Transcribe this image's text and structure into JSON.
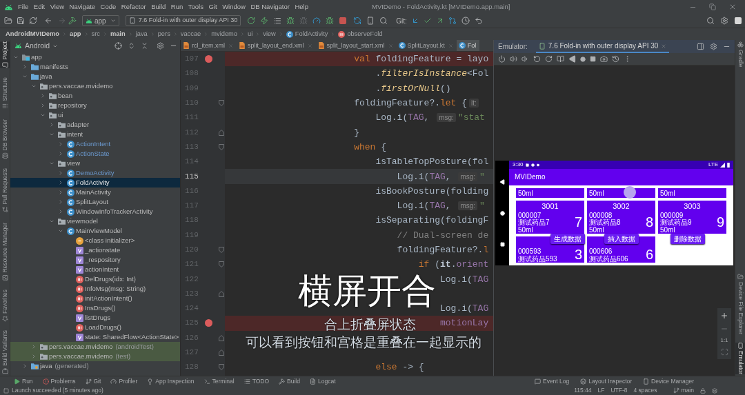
{
  "title_bar": {
    "menu": [
      "File",
      "Edit",
      "View",
      "Navigate",
      "Code",
      "Refactor",
      "Build",
      "Run",
      "Tools",
      "Git",
      "Window",
      "DB Navigator",
      "Help"
    ],
    "title": "MVIDemo - FoldActivity.kt [MVIDemo.app.main]"
  },
  "toolbar": {
    "module": "app",
    "device": "7.6 Fold-in with outer display API 30",
    "git_label": "Git:"
  },
  "breadcrumbs": [
    {
      "label": "AndroidMVIDemo",
      "kind": "root"
    },
    {
      "label": "app",
      "kind": "root"
    },
    {
      "label": "src",
      "kind": "dir"
    },
    {
      "label": "main",
      "kind": "root"
    },
    {
      "label": "java",
      "kind": "dir"
    },
    {
      "label": "pers",
      "kind": "dir"
    },
    {
      "label": "vaccae",
      "kind": "dir"
    },
    {
      "label": "mvidemo",
      "kind": "dir"
    },
    {
      "label": "ui",
      "kind": "dir"
    },
    {
      "label": "view",
      "kind": "dir"
    },
    {
      "label": "FoldActivity",
      "kind": "class"
    },
    {
      "label": "observeFold",
      "kind": "method"
    }
  ],
  "left_tools": {
    "top": [
      {
        "label": "Project",
        "kind": "project",
        "selected": true
      },
      {
        "label": "Structure",
        "kind": "structure",
        "selected": false
      },
      {
        "label": "DB Browser",
        "kind": "database",
        "selected": false
      },
      {
        "label": "Pull Requests",
        "kind": "pull-requests",
        "selected": false
      },
      {
        "label": "Resource Manager",
        "kind": "resources",
        "selected": false
      }
    ],
    "bottom": [
      {
        "label": "Favorites",
        "kind": "favorites",
        "selected": false
      },
      {
        "label": "Build Variants",
        "kind": "build-variants",
        "selected": false
      }
    ]
  },
  "project_panel": {
    "view": "Android",
    "tree": [
      {
        "label": "app",
        "kind": "module",
        "expanded": true,
        "selected": false,
        "children": [
          {
            "label": "manifests",
            "kind": "folder",
            "expanded": false,
            "selected": false
          },
          {
            "label": "java",
            "kind": "folder",
            "expanded": true,
            "selected": false,
            "children": [
              {
                "label": "pers.vaccae.mvidemo",
                "kind": "package",
                "expanded": true,
                "selected": false,
                "test": false,
                "children": [
                  {
                    "label": "bean",
                    "kind": "package",
                    "expanded": false,
                    "selected": false
                  },
                  {
                    "label": "repository",
                    "kind": "package",
                    "expanded": false,
                    "selected": false
                  },
                  {
                    "label": "ui",
                    "kind": "package",
                    "expanded": true,
                    "selected": false,
                    "children": [
                      {
                        "label": "adapter",
                        "kind": "package",
                        "expanded": false,
                        "selected": false
                      },
                      {
                        "label": "intent",
                        "kind": "package",
                        "expanded": true,
                        "selected": false,
                        "children": [
                          {
                            "label": "ActionIntent",
                            "kind": "class",
                            "expanded": false,
                            "selected": false,
                            "modified": true
                          },
                          {
                            "label": "ActionState",
                            "kind": "class",
                            "expanded": false,
                            "selected": false,
                            "modified": true
                          }
                        ]
                      },
                      {
                        "label": "view",
                        "kind": "package",
                        "expanded": true,
                        "selected": false,
                        "children": [
                          {
                            "label": "DemoActivity",
                            "kind": "class",
                            "expanded": false,
                            "selected": false,
                            "modified": true
                          },
                          {
                            "label": "FoldActivity",
                            "kind": "class",
                            "expanded": false,
                            "selected": true,
                            "modified": false
                          },
                          {
                            "label": "MainActivity",
                            "kind": "class",
                            "expanded": false,
                            "selected": false,
                            "modified": false
                          },
                          {
                            "label": "SplitLayout",
                            "kind": "class",
                            "expanded": false,
                            "selected": false,
                            "modified": false
                          },
                          {
                            "label": "WindowInfoTrackerActivity",
                            "kind": "class",
                            "expanded": false,
                            "selected": false,
                            "modified": false
                          }
                        ]
                      },
                      {
                        "label": "viewmodel",
                        "kind": "package",
                        "expanded": true,
                        "selected": false,
                        "children": [
                          {
                            "label": "MainViewModel",
                            "kind": "class",
                            "expanded": true,
                            "selected": false,
                            "modified": false,
                            "children": [
                              {
                                "label": "<class initializer>",
                                "kind": "initializer",
                                "selected": false
                              },
                              {
                                "label": "_actionstate",
                                "kind": "property",
                                "selected": false
                              },
                              {
                                "label": "_respository",
                                "kind": "property",
                                "selected": false
                              },
                              {
                                "label": "actionIntent",
                                "kind": "property",
                                "selected": false
                              },
                              {
                                "label": "DelDrugs(idx: Int)",
                                "kind": "method",
                                "selected": false
                              },
                              {
                                "label": "InfoMsg(msg: String)",
                                "kind": "method",
                                "selected": false
                              },
                              {
                                "label": "initActionIntent()",
                                "kind": "method",
                                "selected": false
                              },
                              {
                                "label": "InsDrugs()",
                                "kind": "method",
                                "selected": false
                              },
                              {
                                "label": "listDrugs",
                                "kind": "property",
                                "selected": false
                              },
                              {
                                "label": "LoadDrugs()",
                                "kind": "method",
                                "selected": false
                              },
                              {
                                "label": "state: SharedFlow<ActionState>",
                                "kind": "property",
                                "selected": false
                              }
                            ]
                          }
                        ]
                      }
                    ]
                  }
                ]
              },
              {
                "label": "pers.vaccae.mvidemo",
                "note": "(androidTest)",
                "kind": "package",
                "expanded": false,
                "selected": false,
                "test": true
              },
              {
                "label": "pers.vaccae.mvidemo",
                "note": "(test)",
                "kind": "package",
                "expanded": false,
                "selected": false,
                "test": true
              }
            ]
          },
          {
            "label": "java",
            "note": "(generated)",
            "kind": "generated",
            "expanded": false,
            "selected": false
          }
        ]
      }
    ]
  },
  "editor": {
    "tabs": [
      {
        "label": "rcl_item.xml",
        "kind": "xml",
        "selected": false
      },
      {
        "label": "split_layout_end.xml",
        "kind": "xml",
        "selected": false
      },
      {
        "label": "split_layout_start.xml",
        "kind": "xml",
        "selected": false
      },
      {
        "label": "SplitLayout.kt",
        "kind": "kotlin",
        "selected": false
      },
      {
        "label": "Fol",
        "kind": "kotlin",
        "selected": true
      }
    ],
    "lines": [
      {
        "number": "107",
        "breakpoint": true,
        "current": false,
        "kind": "plain",
        "code": [
          {
            "kind": "keyword",
            "text": "                        val"
          },
          {
            "kind": "plain",
            "text": " foldingFeature = layo"
          }
        ]
      },
      {
        "number": "108",
        "breakpoint": false,
        "current": false,
        "kind": "plain",
        "code": [
          {
            "kind": "plain",
            "text": "                            ."
          },
          {
            "kind": "call",
            "text": "filterIsInstance"
          },
          {
            "kind": "plain",
            "text": "<Fol"
          }
        ]
      },
      {
        "number": "109",
        "breakpoint": false,
        "current": false,
        "kind": "plain",
        "code": [
          {
            "kind": "plain",
            "text": "                            ."
          },
          {
            "kind": "call",
            "text": "firstOrNull"
          },
          {
            "kind": "plain",
            "text": "()"
          }
        ]
      },
      {
        "number": "110",
        "breakpoint": false,
        "current": false,
        "kind": "fold-start",
        "code": [
          {
            "kind": "plain",
            "text": "                        foldingFeature?."
          },
          {
            "kind": "keyword",
            "text": "let"
          },
          {
            "kind": "plain",
            "text": " {"
          },
          {
            "kind": "hint",
            "text": "it:"
          }
        ]
      },
      {
        "number": "111",
        "breakpoint": false,
        "current": false,
        "kind": "plain",
        "code": [
          {
            "kind": "plain",
            "text": "                            Log.i("
          },
          {
            "kind": "constant",
            "text": "TAG"
          },
          {
            "kind": "plain",
            "text": ", "
          },
          {
            "kind": "hint",
            "text": "msg:"
          },
          {
            "kind": "string",
            "text": "\"stat"
          }
        ]
      },
      {
        "number": "112",
        "breakpoint": false,
        "current": false,
        "kind": "fold-end",
        "code": [
          {
            "kind": "plain",
            "text": "                        }"
          }
        ]
      },
      {
        "number": "113",
        "breakpoint": false,
        "current": false,
        "kind": "fold-start",
        "code": [
          {
            "kind": "keyword",
            "text": "                        when"
          },
          {
            "kind": "plain",
            "text": " {"
          }
        ]
      },
      {
        "number": "114",
        "breakpoint": false,
        "current": false,
        "kind": "plain",
        "code": [
          {
            "kind": "plain",
            "text": "                            isTableTopPosture(fol"
          }
        ]
      },
      {
        "number": "115",
        "breakpoint": false,
        "current": true,
        "kind": "plain",
        "code": [
          {
            "kind": "plain",
            "text": "                                Log.i("
          },
          {
            "kind": "constant",
            "text": "TAG"
          },
          {
            "kind": "plain",
            "text": ", "
          },
          {
            "kind": "hint",
            "text": "msg:"
          },
          {
            "kind": "string",
            "text": "\""
          }
        ]
      },
      {
        "number": "116",
        "breakpoint": false,
        "current": false,
        "kind": "plain",
        "code": [
          {
            "kind": "plain",
            "text": "                            isBookPosture(folding"
          }
        ]
      },
      {
        "number": "117",
        "breakpoint": false,
        "current": false,
        "kind": "plain",
        "code": [
          {
            "kind": "plain",
            "text": "                                Log.i("
          },
          {
            "kind": "constant",
            "text": "TAG"
          },
          {
            "kind": "plain",
            "text": ", "
          },
          {
            "kind": "hint",
            "text": "msg:"
          },
          {
            "kind": "string",
            "text": "\""
          }
        ]
      },
      {
        "number": "118",
        "breakpoint": false,
        "current": false,
        "kind": "plain",
        "code": [
          {
            "kind": "plain",
            "text": "                            isSeparating(foldingF"
          }
        ]
      },
      {
        "number": "119",
        "breakpoint": false,
        "current": false,
        "kind": "plain",
        "code": [
          {
            "kind": "comment",
            "text": "                                // Dual-screen de"
          }
        ]
      },
      {
        "number": "120",
        "breakpoint": false,
        "current": false,
        "kind": "fold-start",
        "code": [
          {
            "kind": "plain",
            "text": "                                foldingFeature?."
          },
          {
            "kind": "keyword",
            "text": "l"
          }
        ]
      },
      {
        "number": "121",
        "breakpoint": false,
        "current": false,
        "kind": "fold-start",
        "code": [
          {
            "kind": "keyword",
            "text": "                                    if"
          },
          {
            "kind": "plain",
            "text": " ("
          },
          {
            "kind": "param",
            "text": "it"
          },
          {
            "kind": "plain",
            "text": "."
          },
          {
            "kind": "constant",
            "text": "orient"
          }
        ]
      },
      {
        "number": "122",
        "breakpoint": false,
        "current": false,
        "kind": "plain",
        "code": [
          {
            "kind": "plain",
            "text": "                                        Log.i("
          },
          {
            "kind": "constant",
            "text": "TAG"
          }
        ]
      },
      {
        "number": "123",
        "breakpoint": false,
        "current": false,
        "kind": "fold-end"
      },
      {
        "number": "124",
        "breakpoint": false,
        "current": false,
        "kind": "plain",
        "code": [
          {
            "kind": "plain",
            "text": "                                        Log.i("
          },
          {
            "kind": "constant",
            "text": "TAG"
          }
        ]
      },
      {
        "number": "125",
        "breakpoint": true,
        "current": false,
        "kind": "plain",
        "code": [
          {
            "kind": "constant",
            "text": "                                        motionLay"
          }
        ]
      },
      {
        "number": "126",
        "breakpoint": false,
        "current": false,
        "kind": "fold-end"
      },
      {
        "number": "127",
        "breakpoint": false,
        "current": false,
        "kind": "fold-end"
      },
      {
        "number": "128",
        "breakpoint": false,
        "current": false,
        "kind": "fold-start",
        "code": [
          {
            "kind": "keyword",
            "text": "                            else"
          },
          {
            "kind": "plain",
            "text": " -> {"
          }
        ]
      }
    ]
  },
  "captions": [
    {
      "text": "横屏开合",
      "kind": "title"
    },
    {
      "text": "合上折叠屏状态",
      "kind": "subtitle"
    },
    {
      "text": "可以看到按钮和宫格是重叠在一起显示的",
      "kind": "subtitle"
    }
  ],
  "emulator": {
    "label": "Emulator:",
    "tabs": [
      {
        "label": "7.6 Fold-in with outer display API 30",
        "selected": true
      }
    ],
    "device": {
      "time": "3:30",
      "network": "LTE",
      "app_title": "MVIDemo",
      "card_rows": [
        {
          "kind": "partial",
          "cards": [
            {
              "lines": [
                "50ml"
              ]
            },
            {
              "lines": [
                "50ml"
              ]
            },
            {
              "lines": [
                "50ml"
              ]
            }
          ]
        },
        {
          "kind": "full",
          "cards": [
            {
              "code": "3001",
              "lines": [
                "000007",
                "测试药品7",
                "50ml"
              ],
              "count": "7"
            },
            {
              "code": "3002",
              "lines": [
                "000008",
                "测试药品8",
                "50ml"
              ],
              "count": "8"
            },
            {
              "code": "3003",
              "lines": [
                "000009",
                "测试药品9",
                "50ml"
              ],
              "count": "9"
            }
          ]
        },
        {
          "kind": "overlapped",
          "cards": [
            {
              "lines": [
                "000593",
                "测试药品593"
              ],
              "count": "3"
            },
            {
              "lines": [
                "000606",
                "测试药品606"
              ],
              "count": "6"
            }
          ]
        }
      ],
      "buttons": [
        "生成数据",
        "插入数据",
        "删除数据"
      ]
    },
    "zoom_label": "1:1"
  },
  "right_tools": {
    "top": [
      {
        "label": "Gradle",
        "kind": "gradle",
        "selected": false
      }
    ],
    "bottom": [
      {
        "label": "Device File Explorer",
        "kind": "files",
        "selected": false
      },
      {
        "label": "Emulator",
        "kind": "emulator",
        "selected": true
      }
    ]
  },
  "bottom_tools": {
    "left": [
      {
        "label": "Run",
        "kind": "run"
      },
      {
        "label": "Problems",
        "kind": "problems"
      },
      {
        "label": "Git",
        "kind": "git"
      },
      {
        "label": "Profiler",
        "kind": "profiler"
      },
      {
        "label": "App Inspection",
        "kind": "inspection"
      },
      {
        "label": "Terminal",
        "kind": "terminal"
      },
      {
        "label": "TODO",
        "kind": "todo"
      },
      {
        "label": "Build",
        "kind": "build"
      },
      {
        "label": "Logcat",
        "kind": "logcat"
      }
    ],
    "right": [
      {
        "label": "Event Log",
        "kind": "event-log"
      },
      {
        "label": "Layout Inspector",
        "kind": "layout-inspector"
      },
      {
        "label": "Device Manager",
        "kind": "device-manager"
      }
    ]
  },
  "status_bar": {
    "message": "Launch succeeded (5 minutes ago)",
    "items": [
      "115:44",
      "LF",
      "UTF-8",
      "4 spaces"
    ],
    "branch": "main"
  }
}
